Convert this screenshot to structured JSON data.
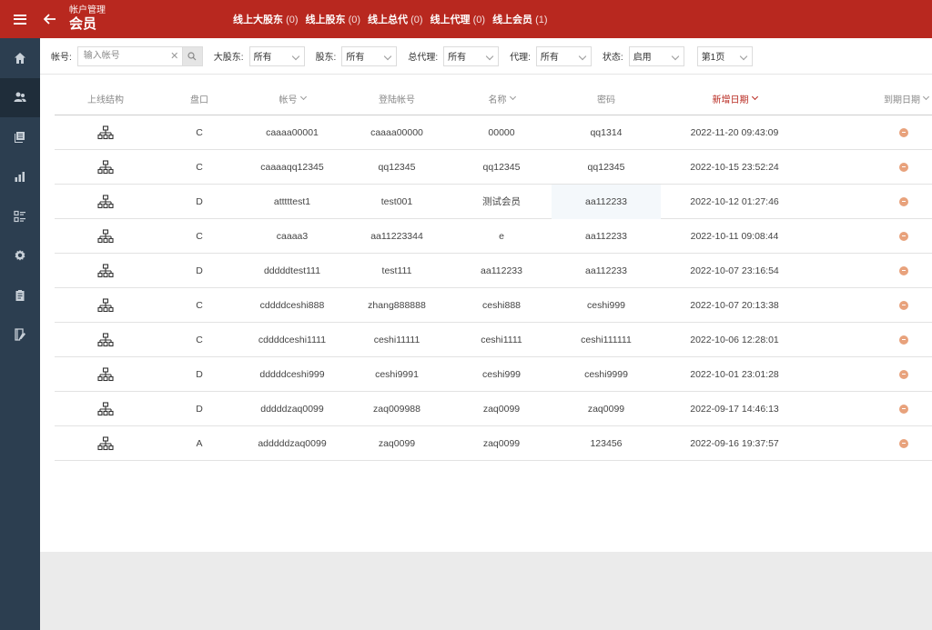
{
  "header": {
    "section": "帐户管理",
    "title": "会员",
    "online": [
      {
        "label": "线上大股东",
        "count": "(0)"
      },
      {
        "label": "线上股东",
        "count": "(0)"
      },
      {
        "label": "线上总代",
        "count": "(0)"
      },
      {
        "label": "线上代理",
        "count": "(0)"
      },
      {
        "label": "线上会员",
        "count": "(1)"
      }
    ]
  },
  "sidebar": {
    "items": [
      "home-icon",
      "users-icon",
      "documents-icon",
      "bar-chart-icon",
      "list-icon",
      "settings-icon",
      "clipboard-icon",
      "report-icon"
    ]
  },
  "filters": {
    "account_label": "帐号:",
    "account_placeholder": "输入帐号",
    "major_shareholder_label": "大股东:",
    "major_shareholder_value": "所有",
    "shareholder_label": "股东:",
    "shareholder_value": "所有",
    "general_agent_label": "总代理:",
    "general_agent_value": "所有",
    "agent_label": "代理:",
    "agent_value": "所有",
    "status_label": "状态:",
    "status_value": "启用",
    "page_value": "第1页"
  },
  "table": {
    "headers": [
      "上线结构",
      "盘口",
      "帐号",
      "登陆帐号",
      "名称",
      "密码",
      "新增日期",
      "到期日期"
    ],
    "rows": [
      {
        "market": "C",
        "account": "caaaa00001",
        "login": "caaaa00000",
        "name": "00000",
        "password": "qq1314",
        "created": "2022-11-20 09:43:09"
      },
      {
        "market": "C",
        "account": "caaaaqq12345",
        "login": "qq12345",
        "name": "qq12345",
        "password": "qq12345",
        "created": "2022-10-15 23:52:24"
      },
      {
        "market": "D",
        "account": "atttttest1",
        "login": "test001",
        "name": "测试会员",
        "password": "aa112233",
        "created": "2022-10-12 01:27:46"
      },
      {
        "market": "C",
        "account": "caaaa3",
        "login": "aa11223344",
        "name": "e",
        "password": "aa112233",
        "created": "2022-10-11 09:08:44"
      },
      {
        "market": "D",
        "account": "dddddtest111",
        "login": "test111",
        "name": "aa112233",
        "password": "aa112233",
        "created": "2022-10-07 23:16:54"
      },
      {
        "market": "C",
        "account": "cddddceshi888",
        "login": "zhang888888",
        "name": "ceshi888",
        "password": "ceshi999",
        "created": "2022-10-07 20:13:38"
      },
      {
        "market": "C",
        "account": "cddddceshi1111",
        "login": "ceshi11111",
        "name": "ceshi1111",
        "password": "ceshi111111",
        "created": "2022-10-06 12:28:01"
      },
      {
        "market": "D",
        "account": "dddddceshi999",
        "login": "ceshi9991",
        "name": "ceshi999",
        "password": "ceshi9999",
        "created": "2022-10-01 23:01:28"
      },
      {
        "market": "D",
        "account": "dddddzaq0099",
        "login": "zaq009988",
        "name": "zaq0099",
        "password": "zaq0099",
        "created": "2022-09-17 14:46:13"
      },
      {
        "market": "A",
        "account": "adddddzaq0099",
        "login": "zaq0099",
        "name": "zaq0099",
        "password": "123456",
        "created": "2022-09-16 19:37:57"
      }
    ]
  },
  "colors": {
    "header_bg": "#b8281f",
    "sidebar_bg": "#2c3e50",
    "status_dot": "#e8a27c"
  }
}
